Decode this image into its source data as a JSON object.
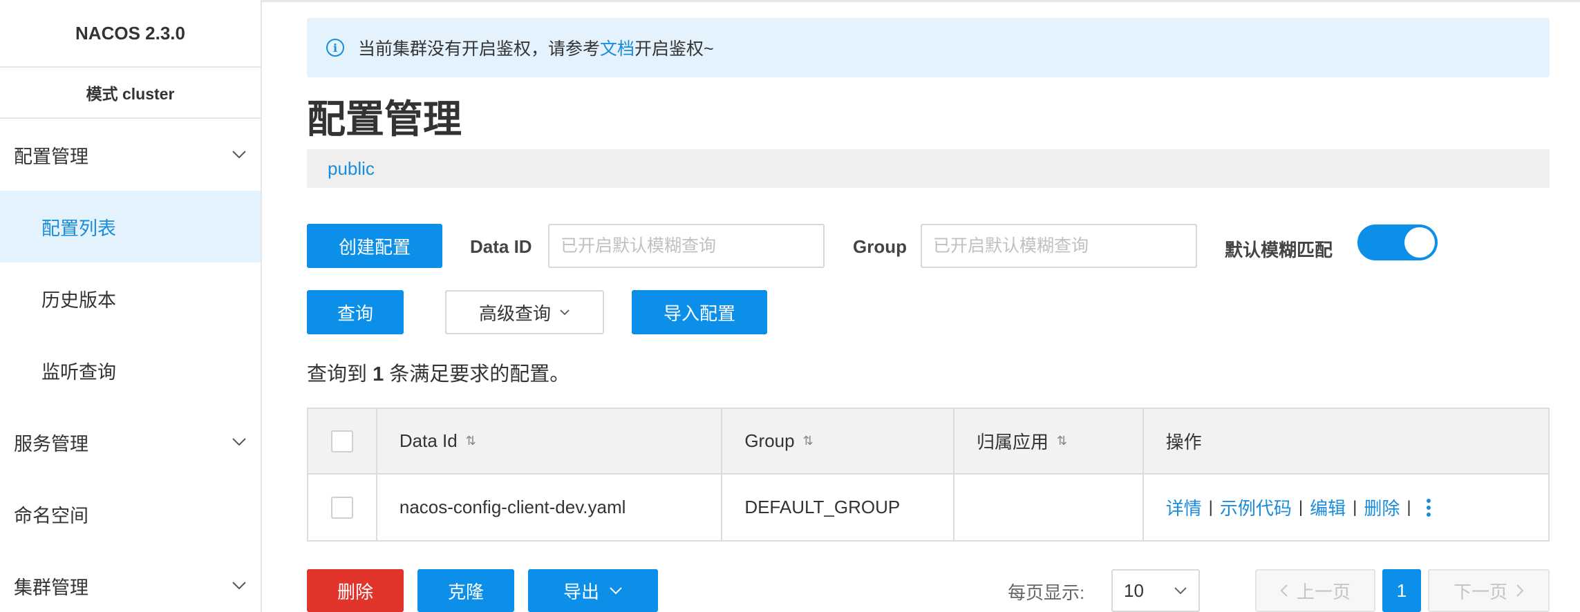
{
  "sidebar": {
    "brand": "NACOS 2.3.0",
    "mode": "模式 cluster",
    "config_group": "配置管理",
    "config_items": [
      "配置列表",
      "历史版本",
      "监听查询"
    ],
    "service_group": "服务管理",
    "namespace": "命名空间",
    "cluster_group": "集群管理"
  },
  "notice": {
    "text_before": "当前集群没有开启鉴权，请参考",
    "link": "文档",
    "text_after": "开启鉴权~"
  },
  "page": {
    "title": "配置管理",
    "namespace": "public"
  },
  "toolbar": {
    "create_label": "创建配置",
    "dataid_label": "Data ID",
    "dataid_placeholder": "已开启默认模糊查询",
    "group_label": "Group",
    "group_placeholder": "已开启默认模糊查询",
    "fuzzy_label": "默认模糊匹配",
    "query_label": "查询",
    "advanced_label": "高级查询",
    "import_label": "导入配置"
  },
  "result": {
    "prefix": "查询到",
    "count": "1",
    "suffix": "条满足要求的配置。"
  },
  "table": {
    "headers": [
      "Data Id",
      "Group",
      "归属应用",
      "操作"
    ],
    "rows": [
      {
        "data_id": "nacos-config-client-dev.yaml",
        "group": "DEFAULT_GROUP",
        "app": "",
        "ops": [
          "详情",
          "示例代码",
          "编辑",
          "删除"
        ]
      }
    ]
  },
  "footer": {
    "delete_label": "删除",
    "clone_label": "克隆",
    "export_label": "导出",
    "page_size_label": "每页显示:",
    "page_size": "10",
    "prev_label": "上一页",
    "current_page": "1",
    "next_label": "下一页"
  }
}
